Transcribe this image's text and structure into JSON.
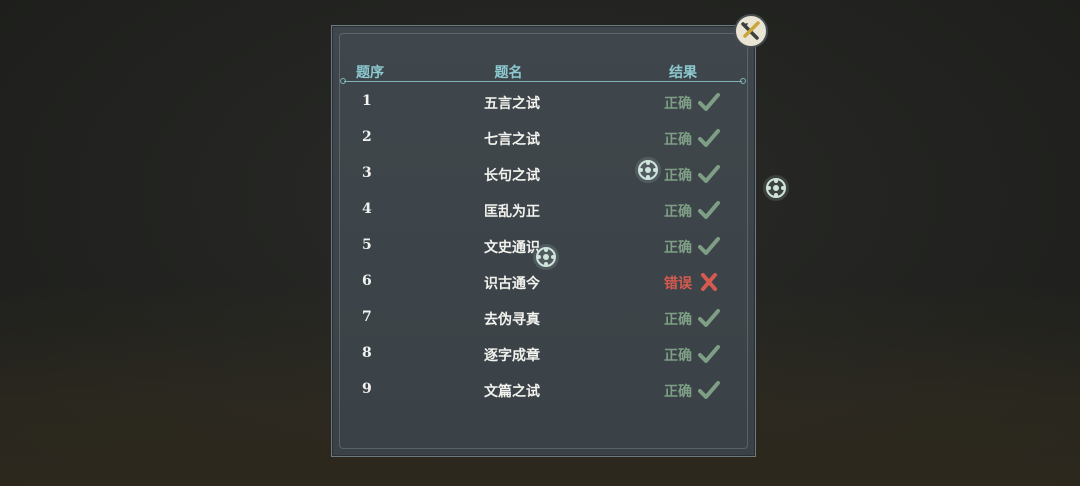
{
  "table": {
    "header": {
      "index": "题序",
      "name": "题名",
      "result": "结果"
    },
    "rows": [
      {
        "index": "1",
        "name": "五言之试",
        "result": "正确",
        "status": "correct"
      },
      {
        "index": "2",
        "name": "七言之试",
        "result": "正确",
        "status": "correct"
      },
      {
        "index": "3",
        "name": "长句之试",
        "result": "正确",
        "status": "correct"
      },
      {
        "index": "4",
        "name": "匡乱为正",
        "result": "正确",
        "status": "correct"
      },
      {
        "index": "5",
        "name": "文史通识",
        "result": "正确",
        "status": "correct"
      },
      {
        "index": "6",
        "name": "识古通今",
        "result": "错误",
        "status": "wrong"
      },
      {
        "index": "7",
        "name": "去伪寻真",
        "result": "正确",
        "status": "correct"
      },
      {
        "index": "8",
        "name": "逐字成章",
        "result": "正确",
        "status": "correct"
      },
      {
        "index": "9",
        "name": "文篇之试",
        "result": "正确",
        "status": "correct"
      }
    ]
  },
  "icons": {
    "close": "close-icon",
    "correct": "check-icon",
    "wrong": "cross-icon",
    "orb": "spirit-orb-icon"
  },
  "colors": {
    "header": "#8cc9d0",
    "correct": "#7f9e86",
    "wrong": "#d65a4f",
    "panel": "#3f474c"
  }
}
